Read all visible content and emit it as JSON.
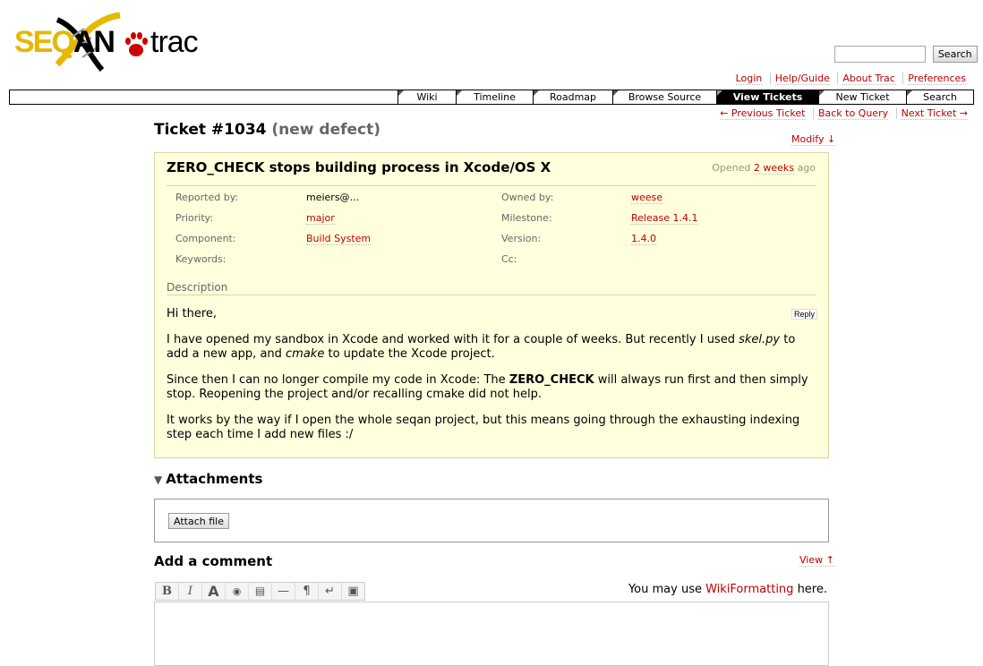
{
  "header": {
    "logo_seq": "SEQ",
    "logo_an": "AN",
    "logo_trac": "trac",
    "search_placeholder": "",
    "search_button": "Search"
  },
  "metanav": [
    "Login",
    "Help/Guide",
    "About Trac",
    "Preferences"
  ],
  "mainnav": {
    "tabs": [
      {
        "label": "Wiki",
        "active": false
      },
      {
        "label": "Timeline",
        "active": false
      },
      {
        "label": "Roadmap",
        "active": false
      },
      {
        "label": "Browse Source",
        "active": false
      },
      {
        "label": "View Tickets",
        "active": true
      },
      {
        "label": "New Ticket",
        "active": false
      },
      {
        "label": "Search",
        "active": false
      }
    ]
  },
  "ctxtnav": [
    "← Previous Ticket",
    "Back to Query",
    "Next Ticket →"
  ],
  "ticket": {
    "title": "Ticket #1034",
    "status": "(new defect)",
    "modify": "Modify ↓",
    "summary": "ZERO_CHECK stops building process in Xcode/OS X",
    "opened_prefix": "Opened",
    "opened_link": "2 weeks",
    "opened_suffix": "ago",
    "props": [
      {
        "l1": "Reported by:",
        "v1": "meiers@…",
        "v1_link": false,
        "l2": "Owned by:",
        "v2": "weese",
        "v2_link": true
      },
      {
        "l1": "Priority:",
        "v1": "major",
        "v1_link": true,
        "l2": "Milestone:",
        "v2": "Release 1.4.1",
        "v2_link": true
      },
      {
        "l1": "Component:",
        "v1": "Build System",
        "v1_link": true,
        "l2": "Version:",
        "v2": "1.4.0",
        "v2_link": true
      },
      {
        "l1": "Keywords:",
        "v1": "",
        "v1_link": false,
        "l2": "Cc:",
        "v2": "",
        "v2_link": false
      }
    ],
    "description_label": "Description",
    "reply": "Reply",
    "desc": {
      "p1": "Hi there,",
      "p2a": "I have opened my sandbox in Xcode and worked with it for a couple of weeks. But recently I used ",
      "p2_em1": "skel.py",
      "p2b": " to add a new app, and ",
      "p2_em2": "cmake",
      "p2c": " to update the Xcode project.",
      "p3a": "Since then I can no longer compile my code in Xcode: The ",
      "p3_strong": "ZERO_CHECK",
      "p3b": " will always run first and then simply stop. Reopening the project and/or recalling cmake did not help.",
      "p4": "It works by the way if I open the whole seqan project, but this means going through the exhausting indexing step each time I add new files :/"
    }
  },
  "attachments": {
    "title": "Attachments",
    "attach_button": "Attach file"
  },
  "comment": {
    "title": "Add a comment",
    "view": "View ↑",
    "hint_prefix": "You may use ",
    "hint_link": "WikiFormatting",
    "hint_suffix": " here.",
    "toolbar": [
      "bold-icon",
      "italic-icon",
      "heading-icon",
      "link-icon",
      "code-block-icon",
      "horizontal-rule-icon",
      "paragraph-icon",
      "line-break-icon",
      "image-icon"
    ],
    "toolbar_glyphs": [
      "B",
      "I",
      "A",
      "◉",
      "▤",
      "—",
      "¶",
      "↵",
      "▣"
    ]
  }
}
